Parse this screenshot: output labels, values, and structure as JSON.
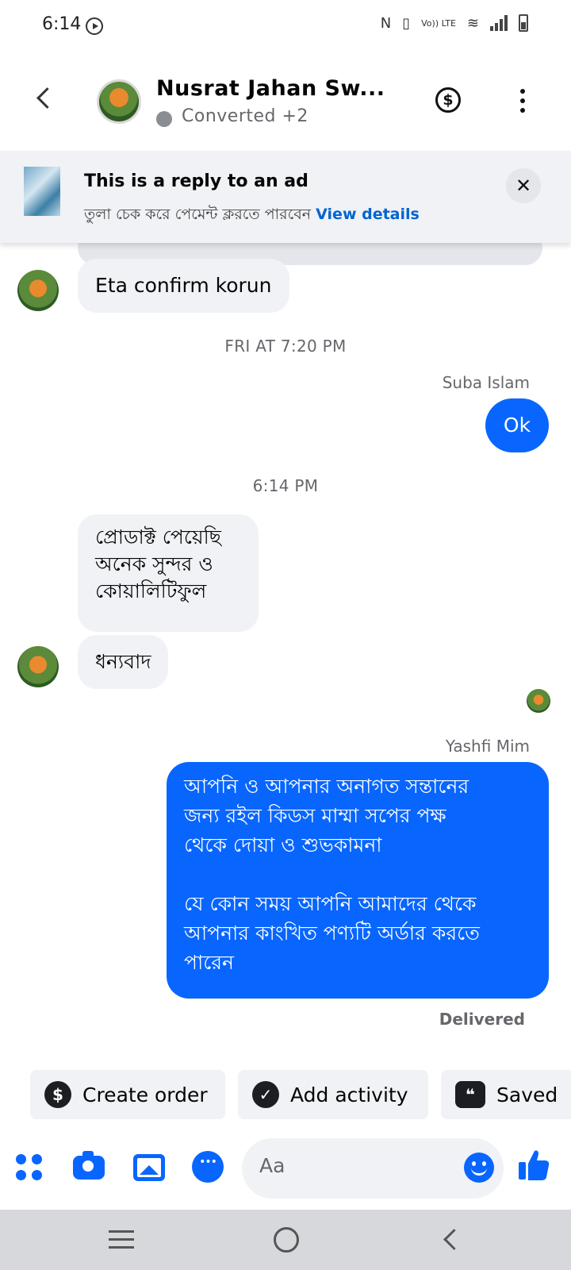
{
  "status_bar": {
    "time": "6:14",
    "volte_label": "Vo)) LTE"
  },
  "header": {
    "contact_name": "Nusrat Jahan Sw...",
    "status_text": "Converted +2",
    "status_dot_color": "#8a8d91"
  },
  "ad_banner": {
    "title": "This is a reply to an ad",
    "subtitle": "তুলা চেক করে পেমেন্ট ক্লরতে পারবেন",
    "link": "View details"
  },
  "messages": {
    "incoming_1": "Eta confirm korun",
    "timestamp_1": "FRI AT 7:20 PM",
    "sender_1": "Suba Islam",
    "outgoing_1": "Ok",
    "timestamp_2": "6:14 PM",
    "incoming_2_lines": [
      "প্রোডাক্ট পেয়েছি",
      "অনেক সুন্দর ও",
      "কোয়ালিটিফুল"
    ],
    "incoming_3": "ধন্যবাদ",
    "sender_2": "Yashfi Mim",
    "outgoing_2_lines": [
      "আপনি ও আপনার অনাগত সন্তানের",
      "জন্য রইল কিডস মাম্মা সপের পক্ষ",
      "থেকে দোয়া ও শুভকামনা",
      "",
      "যে কোন সময় আপনি আমাদের থেকে",
      "আপনার কাংখিত পণ্যটি অর্ডার করতে",
      "পারেন"
    ],
    "delivery_status": "Delivered"
  },
  "quick_actions": [
    {
      "label": "Create order",
      "icon": "dollar-icon"
    },
    {
      "label": "Add activity",
      "icon": "check-circle-icon"
    },
    {
      "label": "Saved",
      "icon": "saved-replies-icon"
    }
  ],
  "composer": {
    "placeholder": "Aa"
  },
  "colors": {
    "accent": "#0866ff",
    "link": "#0064d1",
    "bubble_incoming": "#f0f2f5"
  }
}
